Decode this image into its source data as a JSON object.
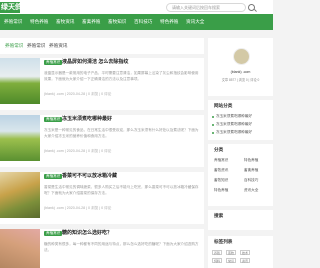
{
  "brand": {
    "logo_text": "绿天鸽",
    "accent": "#3a9e48"
  },
  "search": {
    "placeholder": "请输入关键词后按回车搜索"
  },
  "nav": {
    "items": [
      "养殖常识",
      "特色养殖",
      "畜牧资讯",
      "畜禽养殖",
      "畜牧知识",
      "百科技巧",
      "特色养殖",
      "资讯大全"
    ]
  },
  "tabs": [
    {
      "label": "养殖常识"
    },
    {
      "label": "养殖常识"
    },
    {
      "label": "养殖资讯"
    }
  ],
  "articles": [
    {
      "category": "养殖常识",
      "title": "液晶屏如何清洁 怎么去除指纹",
      "excerpt": "液晶显示器是一款常用的电子产品，平时需要注意清洁，如果屏幕上沾染了灰尘和指纹会影响使用效果，下面就为大家介绍一下正确清洁的方法以及注意事项。",
      "meta": "(blank) .com | 2020-04-28 | 0 浏览 | 0 评论"
    },
    {
      "category": "养殖常识",
      "title": "冻玉米须煮吃哪种最好",
      "excerpt": "冻玉米是一种常见的食品，在日常生活中很受欢迎，那么冻玉米须有什么好处以及煮法呢？下面为大家介绍冻玉米的营养价值和食用方法。",
      "meta": "(blank) .com | 2020-04-28 | 0 浏览 | 0 评论"
    },
    {
      "category": "养殖常识",
      "title": "香菜可不可以放冰箱冷藏",
      "excerpt": "香菜是生活中常见的调味蔬菜，很多人购买之后不能马上吃完，那么香菜可不可以放冰箱冷藏保存呢？下面就为大家介绍香菜的保存方法。",
      "meta": "(blank) .com | 2020-04-28 | 0 浏览 | 0 评论"
    },
    {
      "category": "养殖常识",
      "title": "糖的知识怎么选好吃？",
      "excerpt": "糖的种类有很多，每一种都有不同的用途与特点，那么怎么选好吃的糖呢？下面为大家介绍选购方法。",
      "meta": ""
    }
  ],
  "profile": {
    "name": "(blank) .com",
    "stats": "文章 8577 | 浏览 0 | 评论 0"
  },
  "recent": {
    "title": "网站分类",
    "items": [
      "冻玉米须煮吃哪种最好",
      "冻玉米须煮吃哪种最好",
      "冻玉米须煮吃哪种最好"
    ]
  },
  "categories": {
    "title": "分类",
    "items": [
      "养殖常识",
      "特色养殖",
      "畜牧资讯",
      "畜禽养殖",
      "畜牧知识",
      "百科技巧",
      "特色养殖",
      "资讯大全"
    ]
  },
  "search_box": {
    "title": "搜索"
  },
  "tags": {
    "title": "标签列表",
    "items": [
      "养殖",
      "畜牧",
      "技术",
      "饲料",
      "常识",
      "资讯"
    ]
  }
}
